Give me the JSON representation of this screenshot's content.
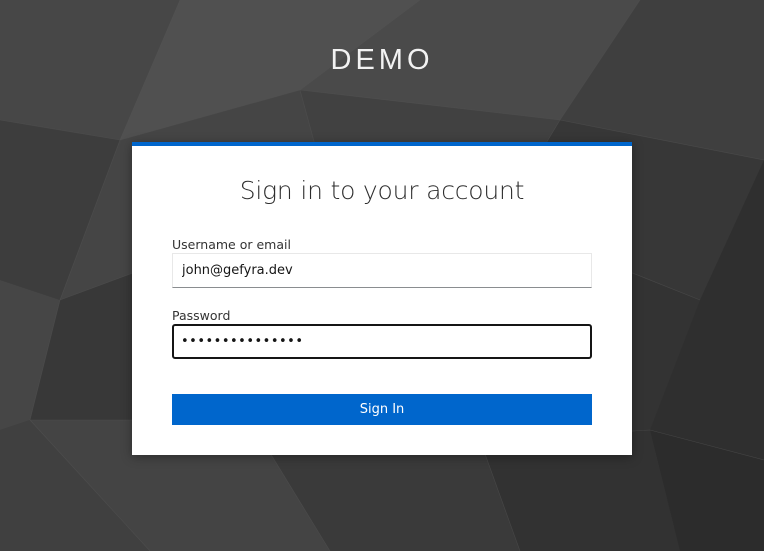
{
  "realm": {
    "title": "DEMO"
  },
  "login": {
    "heading": "Sign in to your account",
    "username_label": "Username or email",
    "username_value": "john@gefyra.dev",
    "password_label": "Password",
    "password_value": "supersecret1234",
    "signin_label": "Sign In"
  },
  "colors": {
    "accent": "#0066cc",
    "background": "#3a3a3a",
    "card": "#ffffff"
  }
}
